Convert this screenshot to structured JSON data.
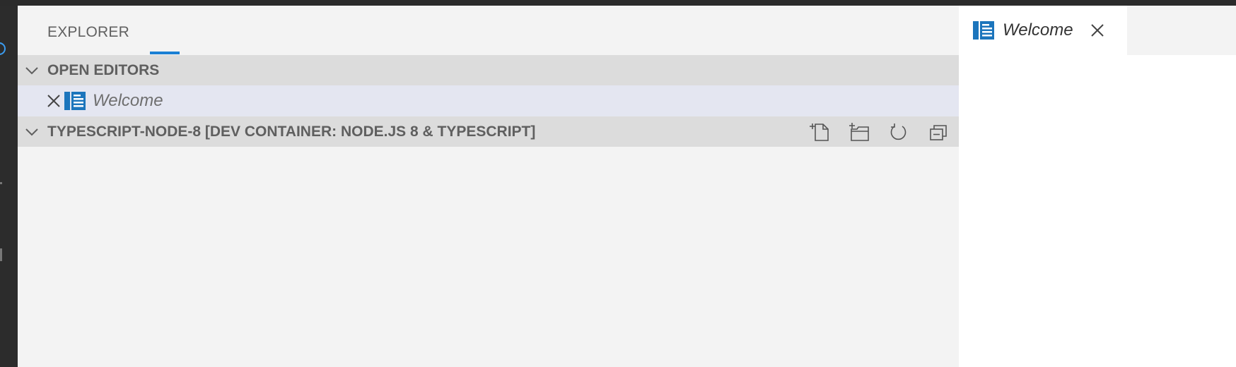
{
  "sidebar": {
    "title": "EXPLORER"
  },
  "open_editors": {
    "header": "OPEN EDITORS",
    "items": [
      {
        "label": "Welcome",
        "icon": "welcome-file-icon"
      }
    ]
  },
  "folder": {
    "header": "TYPESCRIPT-NODE-8 [DEV CONTAINER: NODE.JS 8 & TYPESCRIPT]",
    "actions": [
      "new-file-icon",
      "new-folder-icon",
      "refresh-icon",
      "collapse-all-icon"
    ]
  },
  "editor": {
    "tabs": [
      {
        "label": "Welcome",
        "icon": "welcome-file-icon",
        "active": true
      }
    ]
  },
  "colors": {
    "accent": "#1a7fd4",
    "sidebar_bg": "#f3f3f3",
    "section_bg": "#dcdcdc",
    "selected_row_bg": "#e4e6f1",
    "activity_bar_bg": "#2c2c2c"
  }
}
